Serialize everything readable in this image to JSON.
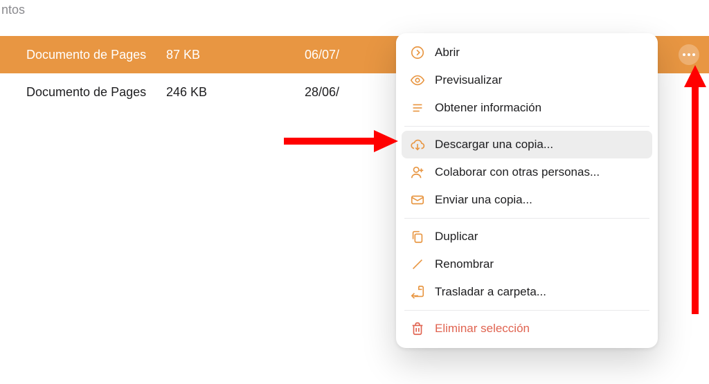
{
  "colors": {
    "accent": "#e89642",
    "destructive": "#e06350"
  },
  "header_fragment": "ntos",
  "rows": [
    {
      "name": "Documento de Pages",
      "size": "87 KB",
      "date": "06/07/"
    },
    {
      "name": "Documento de Pages",
      "size": "246 KB",
      "date": "28/06/"
    }
  ],
  "menu": {
    "open": "Abrir",
    "preview": "Previsualizar",
    "getinfo": "Obtener información",
    "download": "Descargar una copia...",
    "collaborate": "Colaborar con otras personas...",
    "sendcopy": "Enviar una copia...",
    "duplicate": "Duplicar",
    "rename": "Renombrar",
    "move": "Trasladar a carpeta...",
    "delete": "Eliminar selección"
  }
}
